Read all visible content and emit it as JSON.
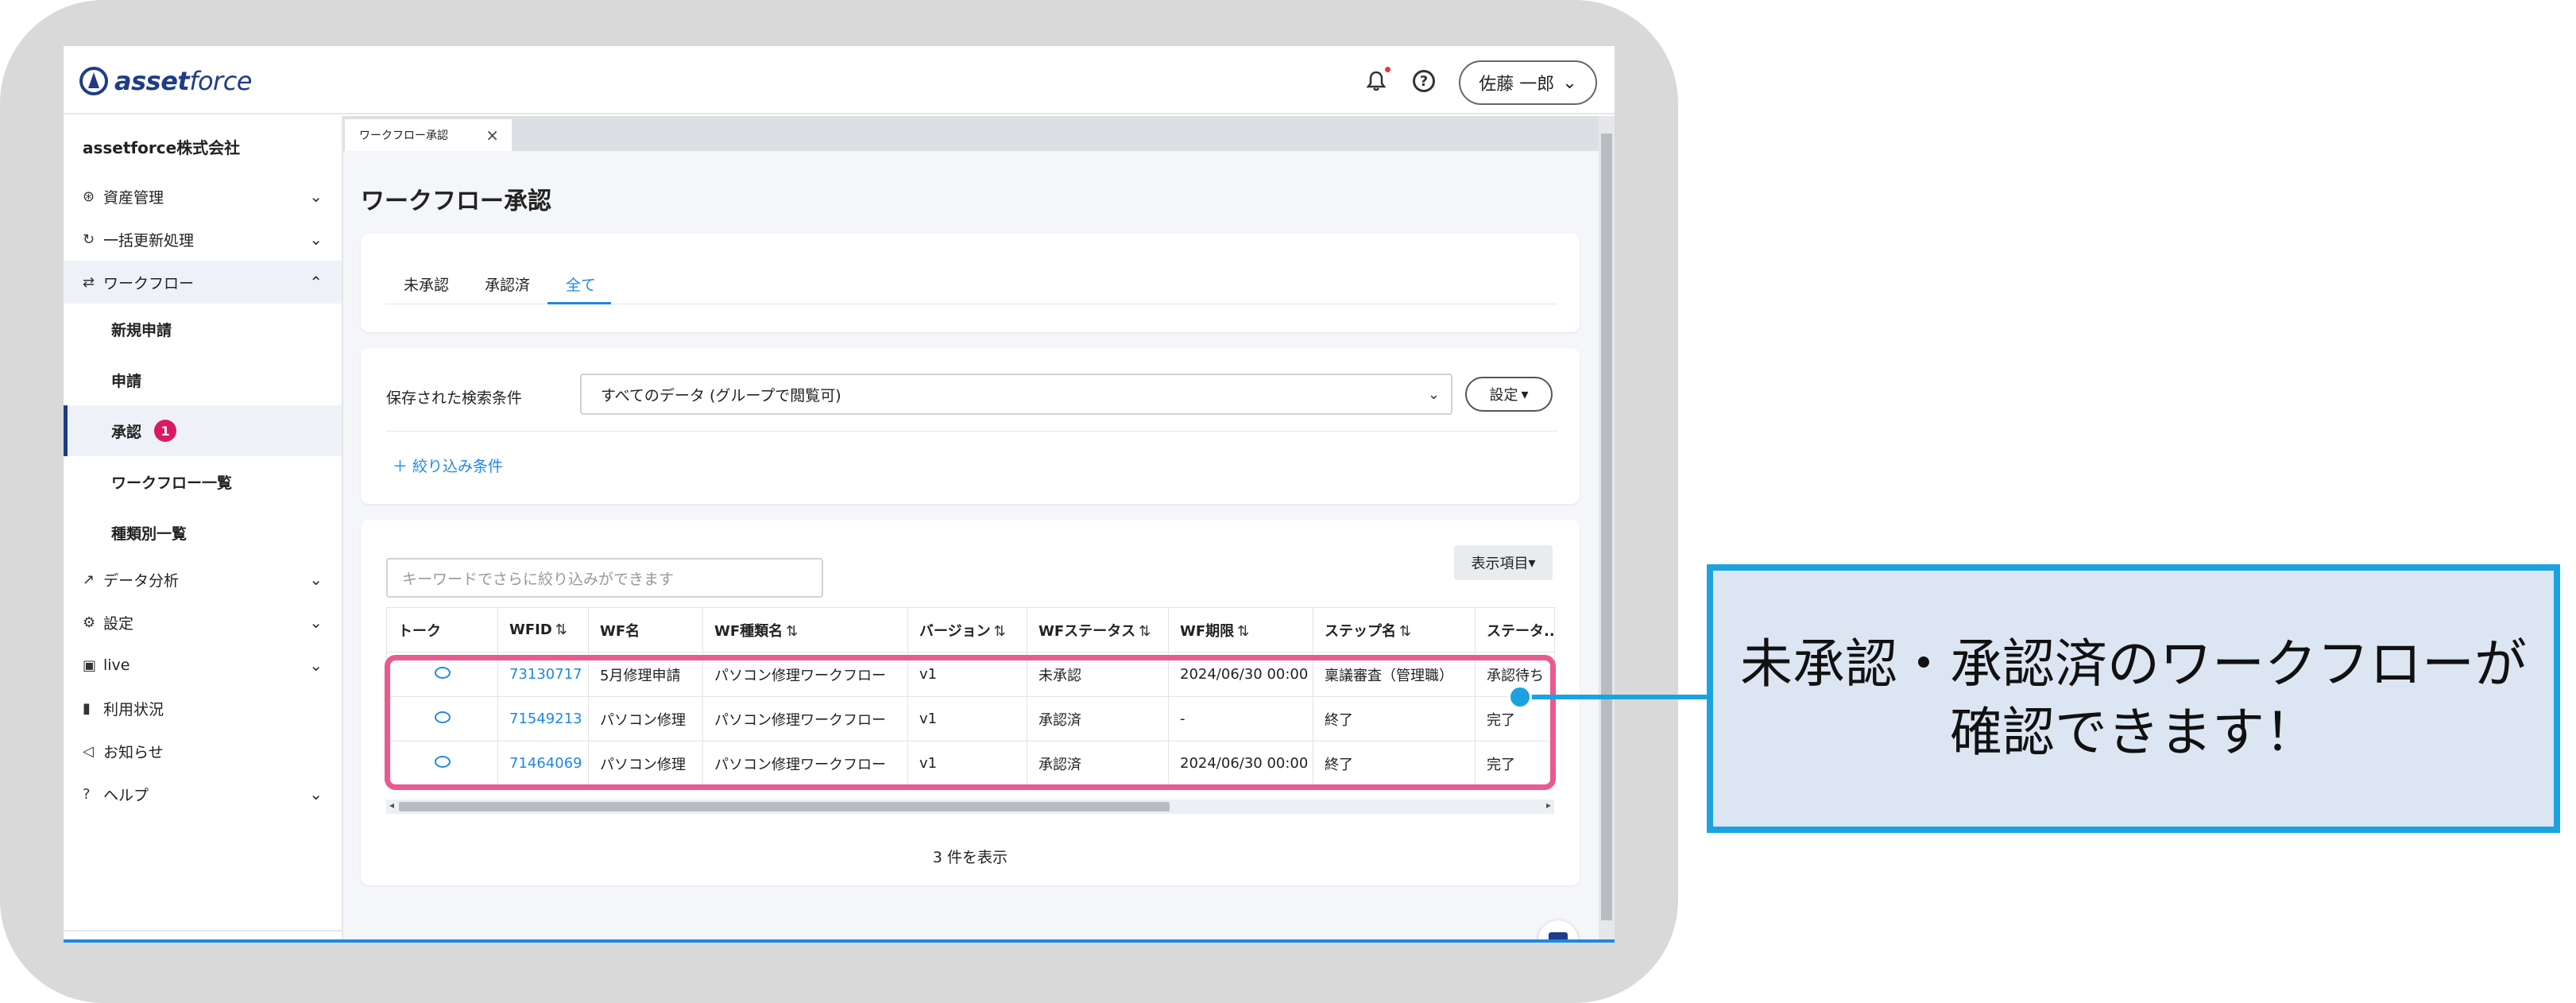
{
  "header": {
    "logo_bold": "asset",
    "logo_light": "force",
    "user_name": "佐藤 一郎"
  },
  "sidebar": {
    "company": "assetforce株式会社",
    "items": [
      {
        "icon": "cube-icon",
        "glyph": "⊛",
        "label": "資産管理"
      },
      {
        "icon": "refresh-icon",
        "glyph": "↻",
        "label": "一括更新処理"
      },
      {
        "icon": "workflow-icon",
        "glyph": "⇄",
        "label": "ワークフロー"
      },
      {
        "icon": "analytics-icon",
        "glyph": "↗",
        "label": "データ分析"
      },
      {
        "icon": "gear-icon",
        "glyph": "⚙",
        "label": "設定"
      },
      {
        "icon": "live-icon",
        "glyph": "▣",
        "label": "live"
      },
      {
        "icon": "bar-chart-icon",
        "glyph": "▮",
        "label": "利用状況"
      },
      {
        "icon": "megaphone-icon",
        "glyph": "◁",
        "label": "お知らせ"
      },
      {
        "icon": "help-icon",
        "glyph": "?",
        "label": "ヘルプ"
      }
    ],
    "workflow_sub": [
      {
        "label": "新規申請"
      },
      {
        "label": "申請"
      },
      {
        "label": "承認",
        "badge": "1"
      },
      {
        "label": "ワークフロー一覧"
      },
      {
        "label": "種類別一覧"
      }
    ]
  },
  "main": {
    "tab_label": "ワークフロー承認",
    "page_title": "ワークフロー承認",
    "status_tabs": [
      "未承認",
      "承認済",
      "全て"
    ],
    "saved_label": "保存された検索条件",
    "saved_value": "すべてのデータ (グループで閲覧可)",
    "settings_label": "設定",
    "filter_link": "＋ 絞り込み条件",
    "keyword_placeholder": "キーワードでさらに絞り込みができます",
    "columns_button": "表示項目",
    "table": {
      "headers": [
        "トーク",
        "WFID",
        "WF名",
        "WF種類名",
        "バージョン",
        "WFステータス",
        "WF期限",
        "ステップ名",
        "ステータ..."
      ],
      "rows": [
        [
          "",
          "73130717",
          "5月修理申請",
          "パソコン修理ワークフロー",
          "v1",
          "未承認",
          "2024/06/30 00:00",
          "稟議審査（管理職）",
          "承認待ち"
        ],
        [
          "",
          "71549213",
          "パソコン修理",
          "パソコン修理ワークフロー",
          "v1",
          "承認済",
          "-",
          "終了",
          "完了"
        ],
        [
          "",
          "71464069",
          "パソコン修理",
          "パソコン修理ワークフロー",
          "v1",
          "承認済",
          "2024/06/30 00:00",
          "終了",
          "完了"
        ]
      ]
    },
    "count_text": "3 件を表示"
  },
  "callout": {
    "line1": "未承認・承認済のワークフローが",
    "line2": "確認できます！"
  },
  "colors": {
    "brand": "#1f3c88",
    "link": "#1e88e5",
    "highlight": "#ea5a8f",
    "callout_border": "#1aa3e0",
    "callout_fill": "#dce6f2"
  }
}
